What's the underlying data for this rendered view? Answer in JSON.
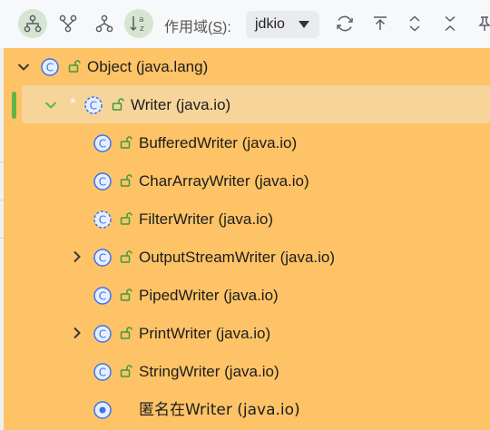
{
  "toolbar": {
    "buttons": [
      {
        "name": "subtypes-hierarchy",
        "active": true
      },
      {
        "name": "supertypes-hierarchy",
        "active": false
      },
      {
        "name": "class-hierarchy",
        "active": false
      },
      {
        "name": "sort-alphabetically",
        "active": true
      }
    ],
    "scope_label_prefix": "作用域(",
    "scope_label_key": "S",
    "scope_label_suffix": "):",
    "scope_value": "jdkio",
    "right_icons": [
      "refresh-icon",
      "export-icon",
      "expand-all-icon",
      "collapse-all-icon",
      "pin-icon"
    ]
  },
  "tree": {
    "root": {
      "label": "Object (java.lang)",
      "expanded": true,
      "icon": "class-icon",
      "access": "public"
    },
    "selected": {
      "label": "Writer (java.io)",
      "expanded": true,
      "icon": "abstract-class-icon",
      "marked": "*",
      "access": "public"
    },
    "children": [
      {
        "label": "BufferedWriter (java.io)",
        "icon": "class-icon",
        "access": "public",
        "expandable": false
      },
      {
        "label": "CharArrayWriter (java.io)",
        "icon": "class-icon",
        "access": "public",
        "expandable": false
      },
      {
        "label": "FilterWriter (java.io)",
        "icon": "abstract-class-icon",
        "access": "public",
        "expandable": false
      },
      {
        "label": "OutputStreamWriter (java.io)",
        "icon": "class-icon",
        "access": "public",
        "expandable": true
      },
      {
        "label": "PipedWriter (java.io)",
        "icon": "class-icon",
        "access": "public",
        "expandable": false
      },
      {
        "label": "PrintWriter (java.io)",
        "icon": "class-icon",
        "access": "public",
        "expandable": true
      },
      {
        "label": "StringWriter (java.io)",
        "icon": "class-icon",
        "access": "public",
        "expandable": false
      },
      {
        "label": "匿名在Writer (java.io)",
        "icon": "anonymous-class-icon",
        "access": "none",
        "expandable": false
      }
    ]
  },
  "colors": {
    "tree_background": "#fec366",
    "selection_background": "#f7d59a",
    "selection_marker": "#62b543",
    "class_icon_blue": "#3574f0",
    "lock_green": "#3b9b3b",
    "toggle_active": "#d5e5d2"
  }
}
